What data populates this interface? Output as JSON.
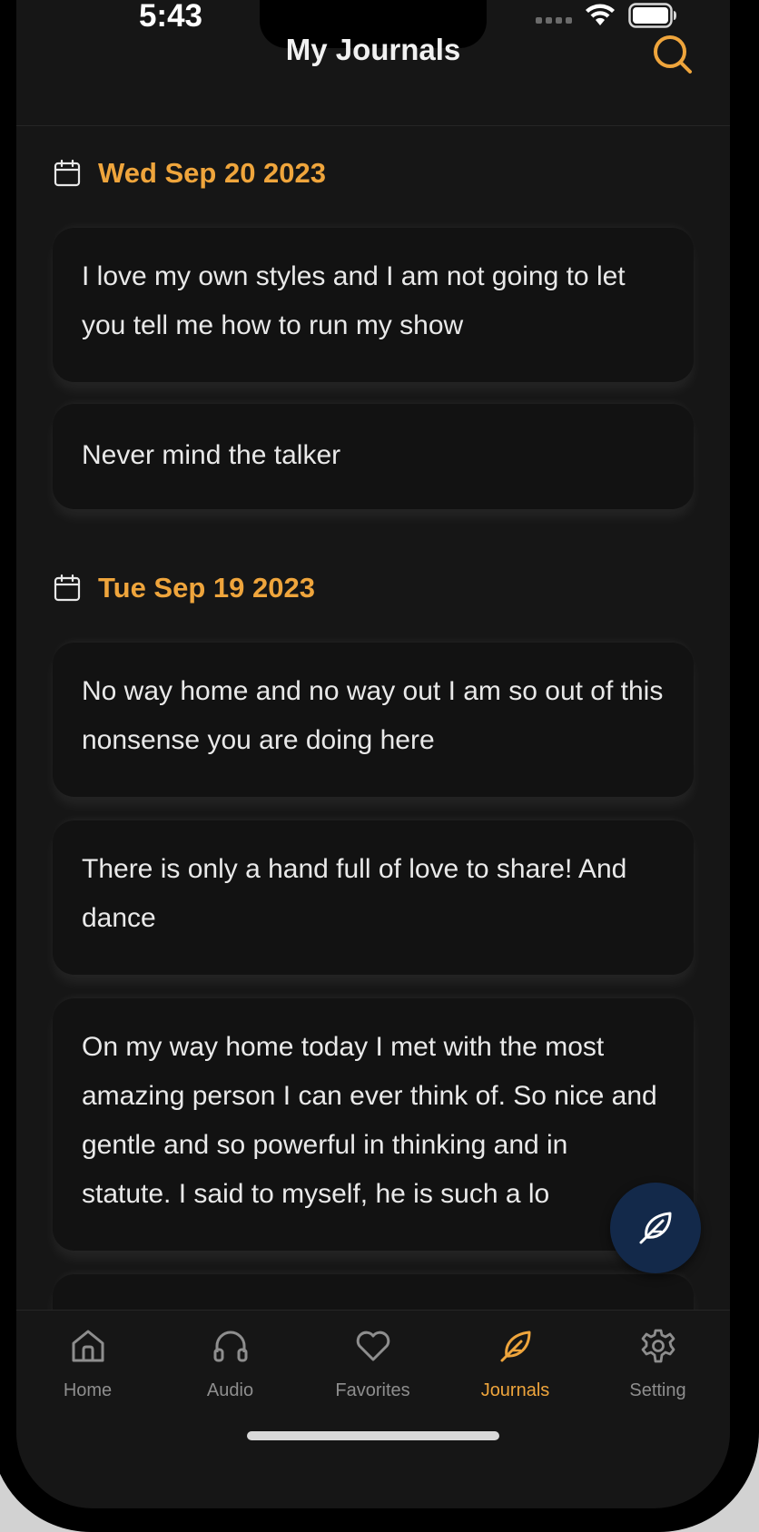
{
  "status": {
    "time": "5:43"
  },
  "header": {
    "title": "My Journals",
    "search_icon": "search-icon"
  },
  "colors": {
    "accent": "#efa53c",
    "background": "#161616",
    "card": "#121212",
    "fab": "#13294a",
    "inactive": "#8e8e8e"
  },
  "journal": {
    "groups": [
      {
        "date": "Wed Sep 20 2023",
        "entries": [
          {
            "text": "I love my own styles and I am not going to let you tell me how to run my show"
          },
          {
            "text": "Never mind the talker"
          }
        ]
      },
      {
        "date": "Tue Sep 19 2023",
        "entries": [
          {
            "text": "No way home and no way out I am so out of this nonsense you are doing here"
          },
          {
            "text": "There is only a hand full of love to share! And dance"
          },
          {
            "text": "On my way home today I met with the most amazing person I can ever think of. So nice and gentle and so powerful in thinking and in statute. I said to myself, he is such a lo"
          }
        ]
      }
    ]
  },
  "fab": {
    "icon": "feather-pen-icon"
  },
  "tabs": [
    {
      "label": "Home",
      "icon": "home-icon",
      "active": false
    },
    {
      "label": "Audio",
      "icon": "headphones-icon",
      "active": false
    },
    {
      "label": "Favorites",
      "icon": "heart-icon",
      "active": false
    },
    {
      "label": "Journals",
      "icon": "feather-icon",
      "active": true
    },
    {
      "label": "Setting",
      "icon": "gear-icon",
      "active": false
    }
  ]
}
